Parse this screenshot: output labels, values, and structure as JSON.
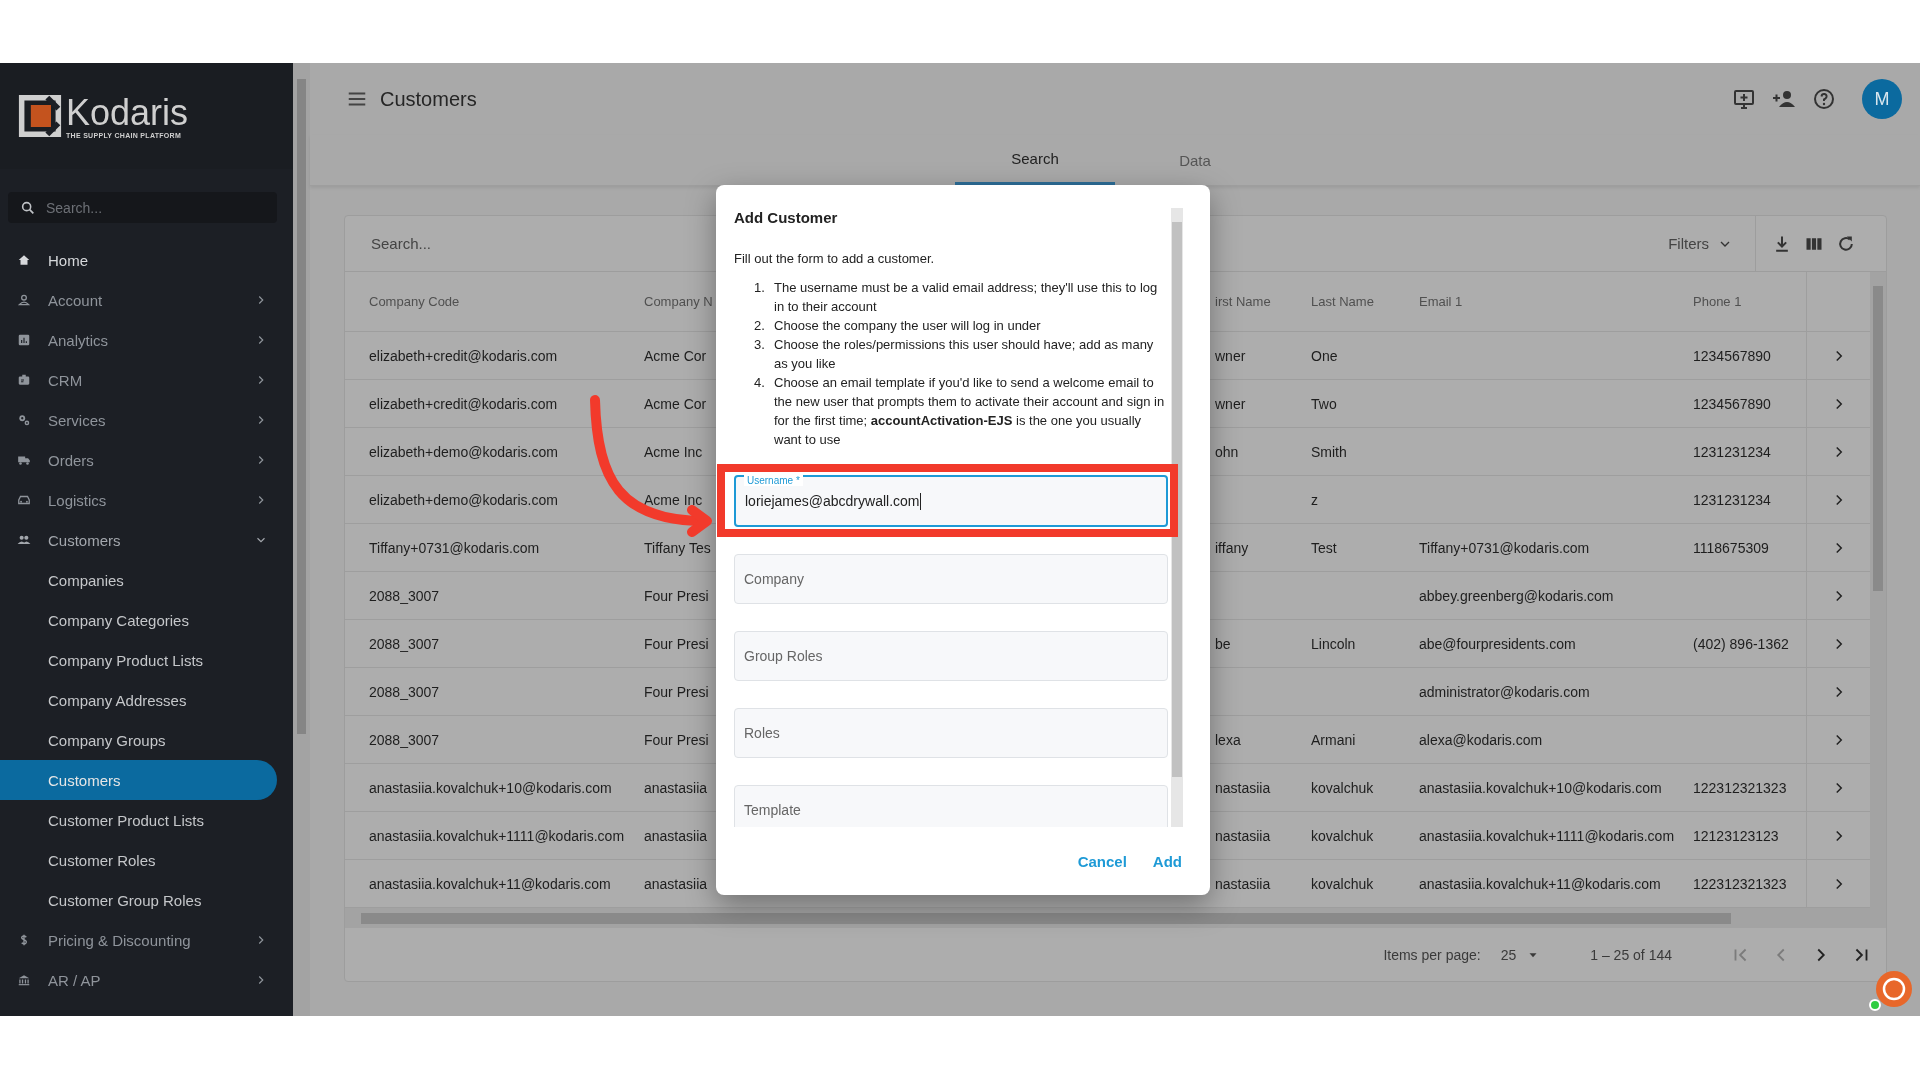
{
  "sidebar": {
    "logo": {
      "name": "Kodaris",
      "tagline": "THE SUPPLY CHAIN PLATFORM"
    },
    "search": {
      "placeholder": "Search..."
    },
    "items": [
      {
        "label": "Home",
        "kind": "link"
      },
      {
        "label": "Account",
        "kind": "group",
        "expanded": false
      },
      {
        "label": "Analytics",
        "kind": "group",
        "expanded": false
      },
      {
        "label": "CRM",
        "kind": "group",
        "expanded": false
      },
      {
        "label": "Services",
        "kind": "group",
        "expanded": false
      },
      {
        "label": "Orders",
        "kind": "group",
        "expanded": false
      },
      {
        "label": "Logistics",
        "kind": "group",
        "expanded": false
      },
      {
        "label": "Customers",
        "kind": "group",
        "expanded": true,
        "children": [
          {
            "label": "Companies",
            "selected": false
          },
          {
            "label": "Company Categories",
            "selected": false
          },
          {
            "label": "Company Product Lists",
            "selected": false
          },
          {
            "label": "Company Addresses",
            "selected": false
          },
          {
            "label": "Company Groups",
            "selected": false
          },
          {
            "label": "Customers",
            "selected": true
          },
          {
            "label": "Customer Product Lists",
            "selected": false
          },
          {
            "label": "Customer Roles",
            "selected": false
          },
          {
            "label": "Customer Group Roles",
            "selected": false
          }
        ]
      },
      {
        "label": "Pricing & Discounting",
        "kind": "group",
        "expanded": false
      },
      {
        "label": "AR / AP",
        "kind": "group",
        "expanded": false
      }
    ]
  },
  "header": {
    "title": "Customers",
    "avatar": "M"
  },
  "tabs": [
    {
      "label": "Search",
      "selected": true
    },
    {
      "label": "Data",
      "selected": false
    }
  ],
  "table": {
    "search": {
      "placeholder": "Search..."
    },
    "filters": "Filters",
    "columns": [
      "Company Code",
      "Company N",
      "irst Name",
      "Last Name",
      "Email 1",
      "Phone 1"
    ],
    "rows": [
      {
        "company_code": "elizabeth+credit@kodaris.com",
        "column_2": "Acme Cor",
        "column_3": "wner",
        "last_name": "One",
        "phone_1": "1234567890"
      },
      {
        "company_code": "elizabeth+credit@kodaris.com",
        "column_2": "Acme Cor",
        "column_3": "wner",
        "last_name": "Two",
        "phone_1": "1234567890"
      },
      {
        "company_code": "elizabeth+demo@kodaris.com",
        "column_2": "Acme Inc",
        "column_3": "ohn",
        "last_name": "Smith",
        "phone_1": "1231231234"
      },
      {
        "company_code": "elizabeth+demo@kodaris.com",
        "column_2": "Acme Inc",
        "last_name": "z",
        "phone_1": "1231231234"
      },
      {
        "company_code": "Tiffany+0731@kodaris.com",
        "column_2": "Tiffany Tes",
        "column_3": "iffany",
        "last_name": "Test",
        "email_1": "Tiffany+0731@kodaris.com",
        "phone_1": "1118675309"
      },
      {
        "company_code": "2088_3007",
        "column_2": "Four Presi",
        "email_1": "abbey.greenberg@kodaris.com"
      },
      {
        "company_code": "2088_3007",
        "column_2": "Four Presi",
        "column_3": "be",
        "last_name": "Lincoln",
        "email_1": "abe@fourpresidents.com",
        "phone_1": "(402) 896-1362"
      },
      {
        "company_code": "2088_3007",
        "column_2": "Four Presi",
        "email_1": "administrator@kodaris.com"
      },
      {
        "company_code": "2088_3007",
        "column_2": "Four Presi",
        "column_3": "lexa",
        "last_name": "Armani",
        "email_1": "alexa@kodaris.com"
      },
      {
        "company_code": "anastasiia.kovalchuk+10@kodaris.com",
        "column_2": "anastasiia",
        "column_3": "nastasiia",
        "last_name": "kovalchuk",
        "email_1": "anastasiia.kovalchuk+10@kodaris.com",
        "phone_1": "122312321323"
      },
      {
        "company_code": "anastasiia.kovalchuk+1111@kodaris.com",
        "column_2": "anastasiia",
        "column_3": "nastasiia",
        "last_name": "kovalchuk",
        "email_1": "anastasiia.kovalchuk+1111@kodaris.com",
        "phone_1": "12123123123"
      },
      {
        "company_code": "anastasiia.kovalchuk+11@kodaris.com",
        "column_2": "anastasiia",
        "column_3": "nastasiia",
        "last_name": "kovalchuk",
        "email_1": "anastasiia.kovalchuk+11@kodaris.com",
        "phone_1": "122312321323"
      }
    ],
    "pagination": {
      "label": "Items per page:",
      "page_size": "25",
      "range": "1 – 25 of 144"
    }
  },
  "dialog": {
    "title": "Add Customer",
    "intro": "Fill out the form to add a customer.",
    "steps": [
      {
        "marker": "1.",
        "text": "The username must be a valid email address; they'll use this to log in to their account"
      },
      {
        "marker": "2.",
        "text": "Choose the company the user will log in under"
      },
      {
        "marker": "3.",
        "text": "Choose the roles/permissions this user should have; add as many as you like"
      },
      {
        "marker": "4.",
        "text": "Choose an email template if you'd like to send a welcome email to the new user that prompts them to activate their account and sign in for the first time; **accountActivation-EJS** is the one you usually want to use"
      }
    ],
    "fields": [
      {
        "label": "Username *",
        "value": "loriejames@abcdrywall.com",
        "focused": true
      },
      {
        "placeholder": "Company",
        "focused": false
      },
      {
        "placeholder": "Group Roles",
        "focused": false
      },
      {
        "placeholder": "Roles",
        "focused": false
      },
      {
        "placeholder": "Template",
        "focused": false
      }
    ],
    "buttons": [
      "Cancel",
      "Add"
    ]
  }
}
